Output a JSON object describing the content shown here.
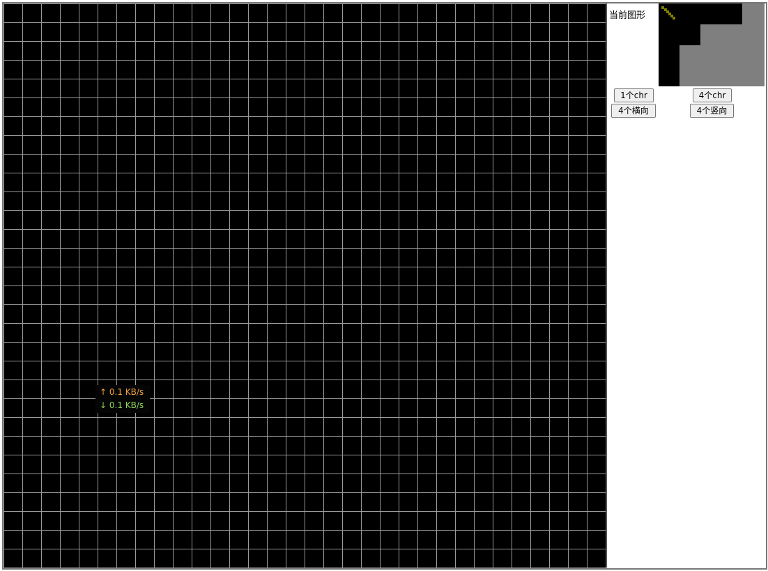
{
  "panel": {
    "current_shape_label": "当前图形"
  },
  "buttons": {
    "one_chr": "1个chr",
    "four_chr": "4个chr",
    "four_horizontal": "4个横向",
    "four_vertical": "4个竖向"
  },
  "net_speed": {
    "upload": "↑ 0.1 KB/s",
    "download": "↓ 0.1 KB/s"
  },
  "colors": {
    "grid_background": "#000000",
    "grid_line": "#9a9a9a",
    "preview_gray": "#7f7f7f",
    "preview_olive": "#808000",
    "upload_text": "#f0a040",
    "download_text": "#8fd65a"
  }
}
